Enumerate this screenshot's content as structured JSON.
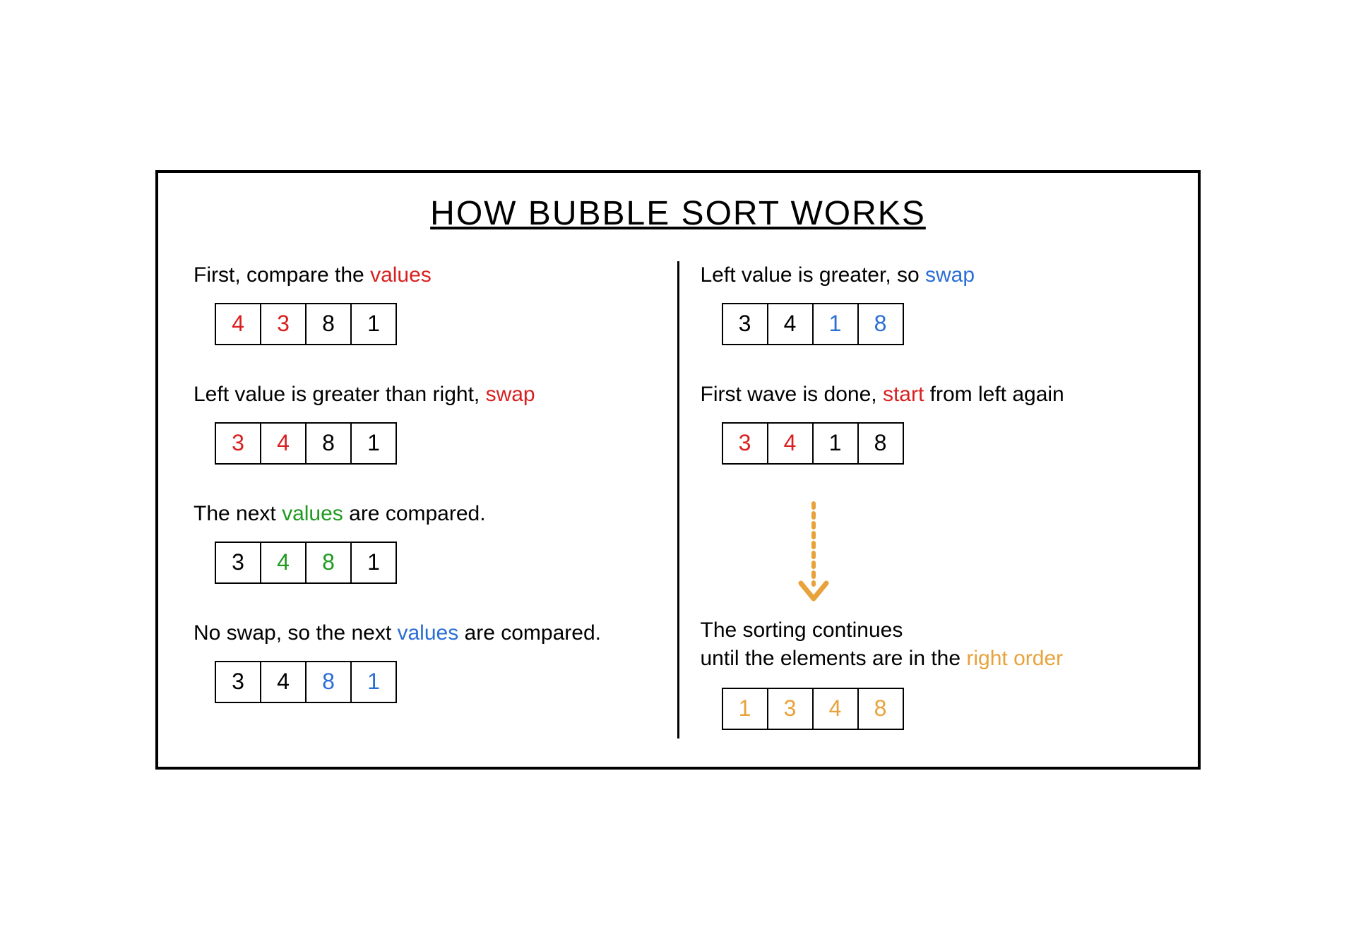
{
  "title": "HOW BUBBLE SORT WORKS",
  "colors": {
    "red": "#d92020",
    "green": "#1f9a1f",
    "blue": "#2a6ed6",
    "orange": "#e8a23a"
  },
  "left": {
    "steps": [
      {
        "text_parts": [
          {
            "text": "First, compare the ",
            "color": ""
          },
          {
            "text": "values",
            "color": "red"
          }
        ],
        "cells": [
          {
            "v": "4",
            "color": "red"
          },
          {
            "v": "3",
            "color": "red"
          },
          {
            "v": "8",
            "color": ""
          },
          {
            "v": "1",
            "color": ""
          }
        ]
      },
      {
        "text_parts": [
          {
            "text": "Left value is greater than right, ",
            "color": ""
          },
          {
            "text": "swap",
            "color": "red"
          }
        ],
        "cells": [
          {
            "v": "3",
            "color": "red"
          },
          {
            "v": "4",
            "color": "red"
          },
          {
            "v": "8",
            "color": ""
          },
          {
            "v": "1",
            "color": ""
          }
        ]
      },
      {
        "text_parts": [
          {
            "text": "The next ",
            "color": ""
          },
          {
            "text": "values",
            "color": "green"
          },
          {
            "text": " are compared.",
            "color": ""
          }
        ],
        "cells": [
          {
            "v": "3",
            "color": ""
          },
          {
            "v": "4",
            "color": "green"
          },
          {
            "v": "8",
            "color": "green"
          },
          {
            "v": "1",
            "color": ""
          }
        ]
      },
      {
        "text_parts": [
          {
            "text": "No swap, so the next ",
            "color": ""
          },
          {
            "text": "values",
            "color": "blue"
          },
          {
            "text": " are compared.",
            "color": ""
          }
        ],
        "cells": [
          {
            "v": "3",
            "color": ""
          },
          {
            "v": "4",
            "color": ""
          },
          {
            "v": "8",
            "color": "blue"
          },
          {
            "v": "1",
            "color": "blue"
          }
        ]
      }
    ]
  },
  "right": {
    "steps": [
      {
        "text_parts": [
          {
            "text": "Left value is greater, so ",
            "color": ""
          },
          {
            "text": "swap",
            "color": "blue"
          }
        ],
        "cells": [
          {
            "v": "3",
            "color": ""
          },
          {
            "v": "4",
            "color": ""
          },
          {
            "v": "1",
            "color": "blue"
          },
          {
            "v": "8",
            "color": "blue"
          }
        ]
      },
      {
        "text_parts": [
          {
            "text": "First wave is done, ",
            "color": ""
          },
          {
            "text": "start",
            "color": "red"
          },
          {
            "text": " from left again",
            "color": ""
          }
        ],
        "cells": [
          {
            "v": "3",
            "color": "red"
          },
          {
            "v": "4",
            "color": "red"
          },
          {
            "v": "1",
            "color": ""
          },
          {
            "v": "8",
            "color": ""
          }
        ]
      }
    ],
    "final_text_parts": [
      {
        "text": "The sorting continues",
        "color": ""
      },
      {
        "text": "\n",
        "color": ""
      },
      {
        "text": "until the elements are in the ",
        "color": ""
      },
      {
        "text": "right order",
        "color": "orange"
      }
    ],
    "final_cells": [
      {
        "v": "1",
        "color": "orange"
      },
      {
        "v": "3",
        "color": "orange"
      },
      {
        "v": "4",
        "color": "orange"
      },
      {
        "v": "8",
        "color": "orange"
      }
    ]
  }
}
